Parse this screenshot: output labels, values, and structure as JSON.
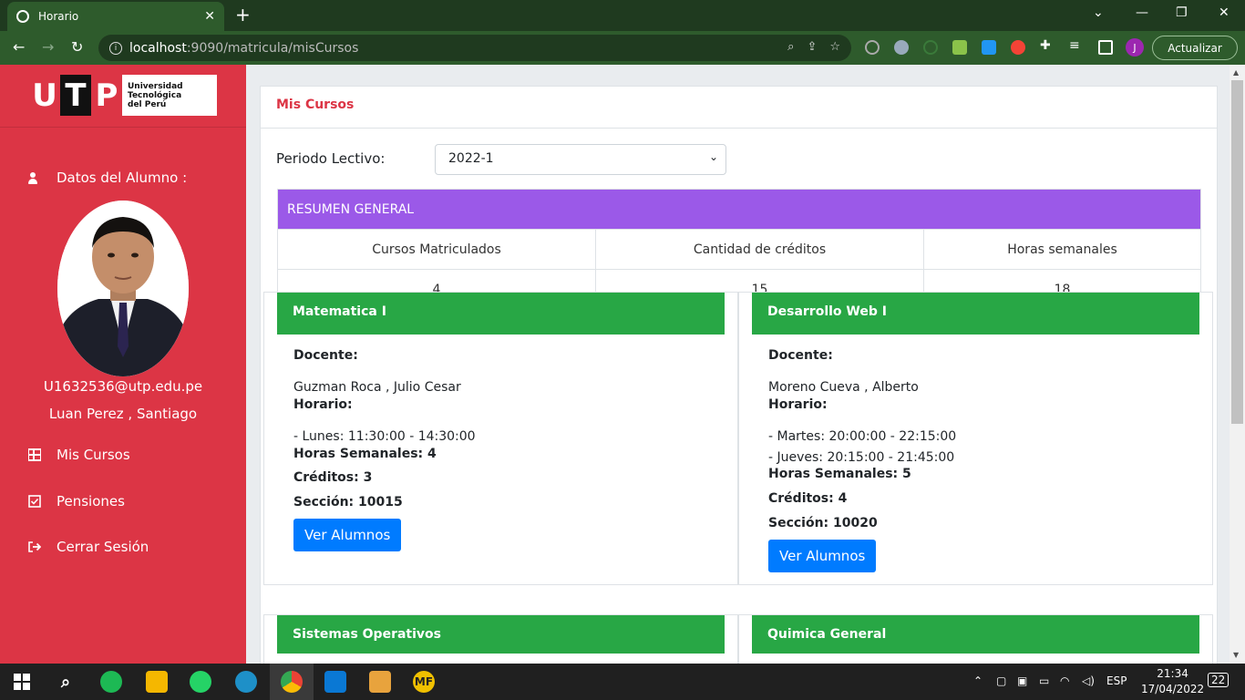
{
  "browser": {
    "tab_title": "Horario",
    "new_tab": "+",
    "url_host": "localhost",
    "url_path": ":9090/matricula/misCursos",
    "update_label": "Actualizar",
    "profile_initial": "J"
  },
  "sidebar": {
    "logo_letters": [
      "U",
      "T",
      "P"
    ],
    "logo_text": [
      "Universidad",
      "Tecnológica",
      "del Perú"
    ],
    "student_heading": "Datos del Alumno :",
    "email": "U1632536@utp.edu.pe",
    "name": "Luan Perez , Santiago",
    "items": [
      {
        "label": "Mis Cursos",
        "icon": "table-icon"
      },
      {
        "label": "Pensiones",
        "icon": "check-square-icon"
      },
      {
        "label": "Cerrar Sesión",
        "icon": "sign-out-icon"
      }
    ],
    "color": "#dc3545"
  },
  "main": {
    "title": "Mis Cursos",
    "period_label": "Periodo Lectivo:",
    "period_value": "2022-1",
    "summary": {
      "heading": "RESUMEN GENERAL",
      "headers": [
        "Cursos Matriculados",
        "Cantidad de créditos",
        "Horas semanales"
      ],
      "values": [
        "4",
        "15",
        "18"
      ]
    },
    "labels": {
      "teacher": "Docente:",
      "schedule": "Horario:",
      "view_students": "Ver Alumnos"
    },
    "courses": [
      {
        "name": "Matematica I",
        "teacher": "Guzman Roca , Julio Cesar",
        "schedule": [
          "- Lunes: 11:30:00 - 14:30:00"
        ],
        "hours": "Horas Semanales: 4",
        "credits": "Créditos: 3",
        "section": "Sección: 10015"
      },
      {
        "name": "Desarrollo Web I",
        "teacher": "Moreno Cueva , Alberto",
        "schedule": [
          "- Martes: 20:00:00 - 22:15:00",
          "- Jueves: 20:15:00 - 21:45:00"
        ],
        "hours": "Horas Semanales: 5",
        "credits": "Créditos: 4",
        "section": "Sección: 10020"
      },
      {
        "name": "Sistemas Operativos"
      },
      {
        "name": "Quimica General"
      }
    ]
  },
  "taskbar": {
    "lang": "ESP",
    "time": "21:34",
    "date": "17/04/2022",
    "notifications": "22"
  }
}
